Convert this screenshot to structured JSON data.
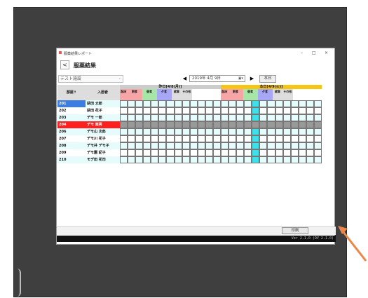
{
  "window": {
    "title": "服薬結果レポート",
    "page_title": "服薬結果"
  },
  "toolbar": {
    "facility": "テスト施設",
    "date": "2019年 4月 9日",
    "today_label": "本日",
    "prev": "◀",
    "next": "▶"
  },
  "columns": {
    "room": "部屋↑",
    "resident": "入居者",
    "day1": "昨日[4/8(月)]",
    "day2": "本日[4/9(火)]",
    "slots": [
      "起床",
      "朝食",
      "昼食",
      "夕食",
      "就寝",
      "その他"
    ],
    "subs": [
      "前",
      "後"
    ]
  },
  "rows": [
    {
      "room": "201",
      "name": "荻田 太郎",
      "highlight": "blue"
    },
    {
      "room": "202",
      "name": "荻田 花子",
      "highlight": "none"
    },
    {
      "room": "203",
      "name": "デモ 一郎",
      "highlight": "none"
    },
    {
      "room": "204",
      "name": "デモ 楽男",
      "highlight": "red"
    },
    {
      "room": "206",
      "name": "デモ山 次郎",
      "highlight": "none"
    },
    {
      "room": "207",
      "name": "デモ川 花子",
      "highlight": "none"
    },
    {
      "room": "208",
      "name": "デモ井 デモ子",
      "highlight": "none"
    },
    {
      "room": "209",
      "name": "デモ園 紀子",
      "highlight": "none"
    },
    {
      "room": "210",
      "name": "モデ田 花司",
      "highlight": "none"
    }
  ],
  "footer": {
    "print_label": "印刷",
    "version": "Ver 2.1.0 (DV 2.1.0)"
  }
}
